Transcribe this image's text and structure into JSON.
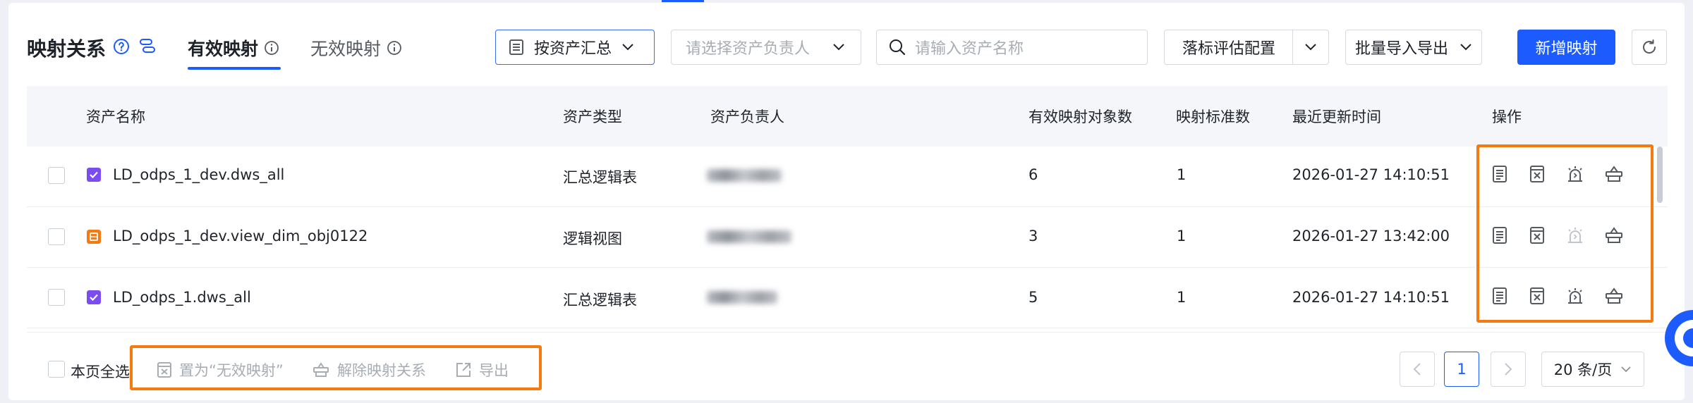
{
  "header": {
    "title": "映射关系",
    "tabs": [
      {
        "label": "有效映射",
        "active": true
      },
      {
        "label": "无效映射",
        "active": false
      }
    ],
    "group_by": {
      "label": "按资产汇总"
    },
    "owner_select": {
      "placeholder": "请选择资产负责人"
    },
    "search": {
      "placeholder": "请输入资产名称"
    },
    "config_button": "落标评估配置",
    "batch_button": "批量导入导出",
    "primary_button": "新增映射"
  },
  "table": {
    "columns": [
      "资产名称",
      "资产类型",
      "资产负责人",
      "有效映射对象数",
      "映射标准数",
      "最近更新时间",
      "操作"
    ],
    "rows": [
      {
        "name": "LD_odps_1_dev.dws_all",
        "type": "汇总逻辑表",
        "objects": "6",
        "standards": "1",
        "updated": "2026-01-27 14:10:51",
        "icon": "summary-table-icon",
        "icon_color": "#7b4cf0"
      },
      {
        "name": "LD_odps_1_dev.view_dim_obj0122",
        "type": "逻辑视图",
        "objects": "3",
        "standards": "1",
        "updated": "2026-01-27 13:42:00",
        "icon": "logical-view-icon",
        "icon_color": "#f57a0f"
      },
      {
        "name": "LD_odps_1.dws_all",
        "type": "汇总逻辑表",
        "objects": "5",
        "standards": "1",
        "updated": "2026-01-27 14:10:51",
        "icon": "summary-table-icon",
        "icon_color": "#7b4cf0"
      }
    ]
  },
  "footer": {
    "select_all": "本页全选",
    "bulk_actions": [
      "置为“无效映射”",
      "解除映射关系",
      "导出"
    ],
    "current_page": "1",
    "page_size": "20 条/页"
  },
  "colors": {
    "accent": "#1c5cff",
    "highlight": "#f57a0f"
  }
}
